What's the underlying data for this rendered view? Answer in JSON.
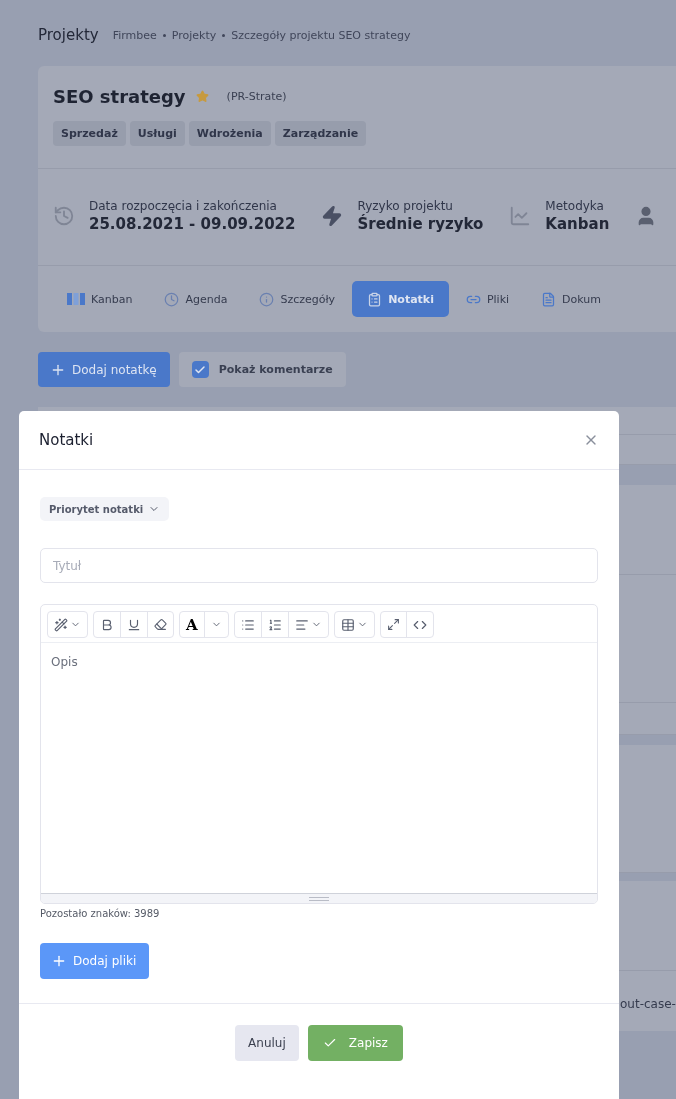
{
  "header": {
    "title": "Projekty",
    "breadcrumb": [
      "Firmbee",
      "Projekty",
      "Szczegóły projektu SEO strategy"
    ]
  },
  "project": {
    "name": "SEO strategy",
    "starred": true,
    "code": "(PR-Strate)",
    "tags": [
      "Sprzedaż",
      "Usługi",
      "Wdrożenia",
      "Zarządzanie"
    ]
  },
  "meta": [
    {
      "kind": "dates",
      "label": "Data rozpoczęcia i zakończenia",
      "value": "25.08.2021 - 09.09.2022"
    },
    {
      "kind": "risk",
      "label": "Ryzyko projektu",
      "value": "Średnie ryzyko"
    },
    {
      "kind": "method",
      "label": "Metodyka",
      "value": "Kanban"
    },
    {
      "kind": "person"
    }
  ],
  "tabs": [
    {
      "kind": "kanban",
      "label": "Kanban",
      "selected": false
    },
    {
      "kind": "agenda",
      "label": "Agenda",
      "selected": false
    },
    {
      "kind": "details",
      "label": "Szczegóły",
      "selected": false
    },
    {
      "kind": "notes",
      "label": "Notatki",
      "selected": true
    },
    {
      "kind": "files",
      "label": "Pliki",
      "selected": false
    },
    {
      "kind": "docs",
      "label": "Dokum",
      "selected": false
    }
  ],
  "actions": {
    "add_note": "Dodaj notatkę",
    "show_comments": {
      "label": "Pokaż komentarze",
      "checked": true
    }
  },
  "background_text": "out-case-",
  "modal": {
    "title": "Notatki",
    "priority": "Priorytet notatki",
    "title_field": {
      "placeholder": "Tytuł"
    },
    "editor": {
      "font_color_glyph": "A",
      "placeholder": "Opis"
    },
    "remaining": "Pozostało znaków: 3989",
    "add_files": "Dodaj pliki",
    "cancel": "Anuluj",
    "save": "Zapisz"
  }
}
